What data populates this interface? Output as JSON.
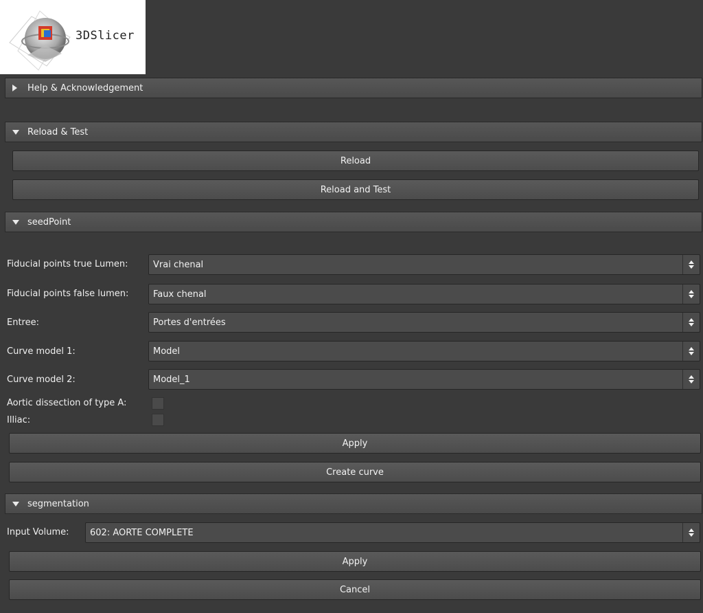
{
  "logo": {
    "text": "3DSlicer"
  },
  "sections": {
    "help": {
      "label": "Help & Acknowledgement",
      "expanded": false
    },
    "reload": {
      "label": "Reload & Test",
      "expanded": true,
      "reload_button": "Reload",
      "reload_test_button": "Reload and Test"
    },
    "seedpoint": {
      "label": "seedPoint",
      "expanded": true,
      "fields": [
        {
          "label": "Fiducial points true Lumen:",
          "value": "Vrai chenal"
        },
        {
          "label": "Fiducial points false lumen:",
          "value": "Faux chenal"
        },
        {
          "label": "Entree:",
          "value": "Portes d'entrées"
        },
        {
          "label": "Curve model 1:",
          "value": "Model"
        },
        {
          "label": "Curve model 2:",
          "value": "Model_1"
        }
      ],
      "checkboxes": [
        {
          "label": "Aortic dissection of type A:",
          "checked": false
        },
        {
          "label": "Illiac:",
          "checked": false
        }
      ],
      "apply_button": "Apply",
      "create_curve_button": "Create curve"
    },
    "segmentation": {
      "label": "segmentation",
      "expanded": true,
      "input_volume_label": "Input Volume:",
      "input_volume_value": "602: AORTE COMPLETE",
      "apply_button": "Apply",
      "cancel_button": "Cancel"
    }
  },
  "colors": {
    "panel_bg": "#3a3a3a",
    "header_bg": "#505050",
    "text": "#f0f0f0"
  }
}
